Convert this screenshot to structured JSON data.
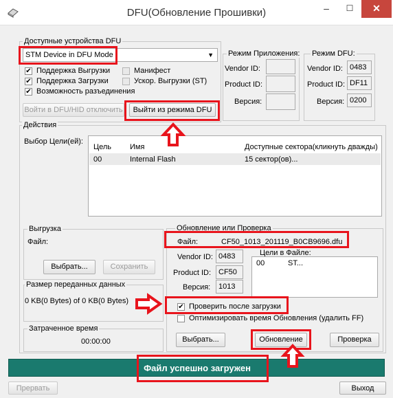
{
  "window": {
    "title": "DFU(Обновление Прошивки)",
    "minimize": "–",
    "maximize": "☐",
    "close": "✕"
  },
  "devices": {
    "group_label": "Доступные устройства DFU",
    "selected": "STM Device in DFU Mode",
    "chk_upload": "Поддержка Выгрузки",
    "chk_download": "Поддержка Загрузки",
    "chk_detach": "Возможность разъединения",
    "chk_manifest": "Манифест",
    "chk_accel": "Ускор. Выгрузки (ST)",
    "btn_enter": "Войти в DFU/HID отключить",
    "btn_leave": "Выйти из режима DFU"
  },
  "app_mode": {
    "label": "Режим Приложения:",
    "vendor_label": "Vendor ID:",
    "product_label": "Product ID:",
    "version_label": "Версия:",
    "vendor": "",
    "product": "",
    "version": ""
  },
  "dfu_mode": {
    "label": "Режим DFU:",
    "vendor_label": "Vendor ID:",
    "product_label": "Product ID:",
    "version_label": "Версия:",
    "vendor": "0483",
    "product": "DF11",
    "version": "0200"
  },
  "actions": {
    "group_label": "Действия",
    "targets_label": "Выбор Цели(ей):",
    "columns": [
      "Цель",
      "Имя",
      "Доступные сектора(кликнуть дважды)"
    ],
    "rows": [
      {
        "target": "00",
        "name": "Internal Flash",
        "sectors": "15 сектор(ов)..."
      }
    ]
  },
  "upload": {
    "group_label": "Выгрузка",
    "file_label": "Файл:",
    "choose": "Выбрать...",
    "save": "Сохранить"
  },
  "transfer": {
    "group_label": "Размер переданных данных",
    "value": "0 KB(0 Bytes) of 0 KB(0 Bytes)"
  },
  "elapsed": {
    "group_label": "Затраченное время",
    "value": "00:00:00"
  },
  "update": {
    "group_label": "Обновление или Проверка",
    "file_label": "Файл:",
    "file_name": "CF50_1013_201119_B0CB9696.dfu",
    "vendor_label": "Vendor ID:",
    "product_label": "Product ID:",
    "version_label": "Версия:",
    "vendor": "0483",
    "product": "CF50",
    "version": "1013",
    "targets_in_file_label": "Цели в Файле:",
    "target_id": "00",
    "target_name": "ST...",
    "chk_verify": "Проверить после загрузки",
    "chk_optimize": "Оптимизировать время Обновления (удалить FF)",
    "choose": "Выбрать...",
    "upgrade": "Обновление",
    "verify": "Проверка"
  },
  "status": {
    "message": "Файл успешно загружен",
    "color": "#1a7a6e"
  },
  "footer": {
    "abort": "Прервать",
    "exit": "Выход"
  },
  "annotation": {
    "highlight_color": "#e8141c"
  }
}
